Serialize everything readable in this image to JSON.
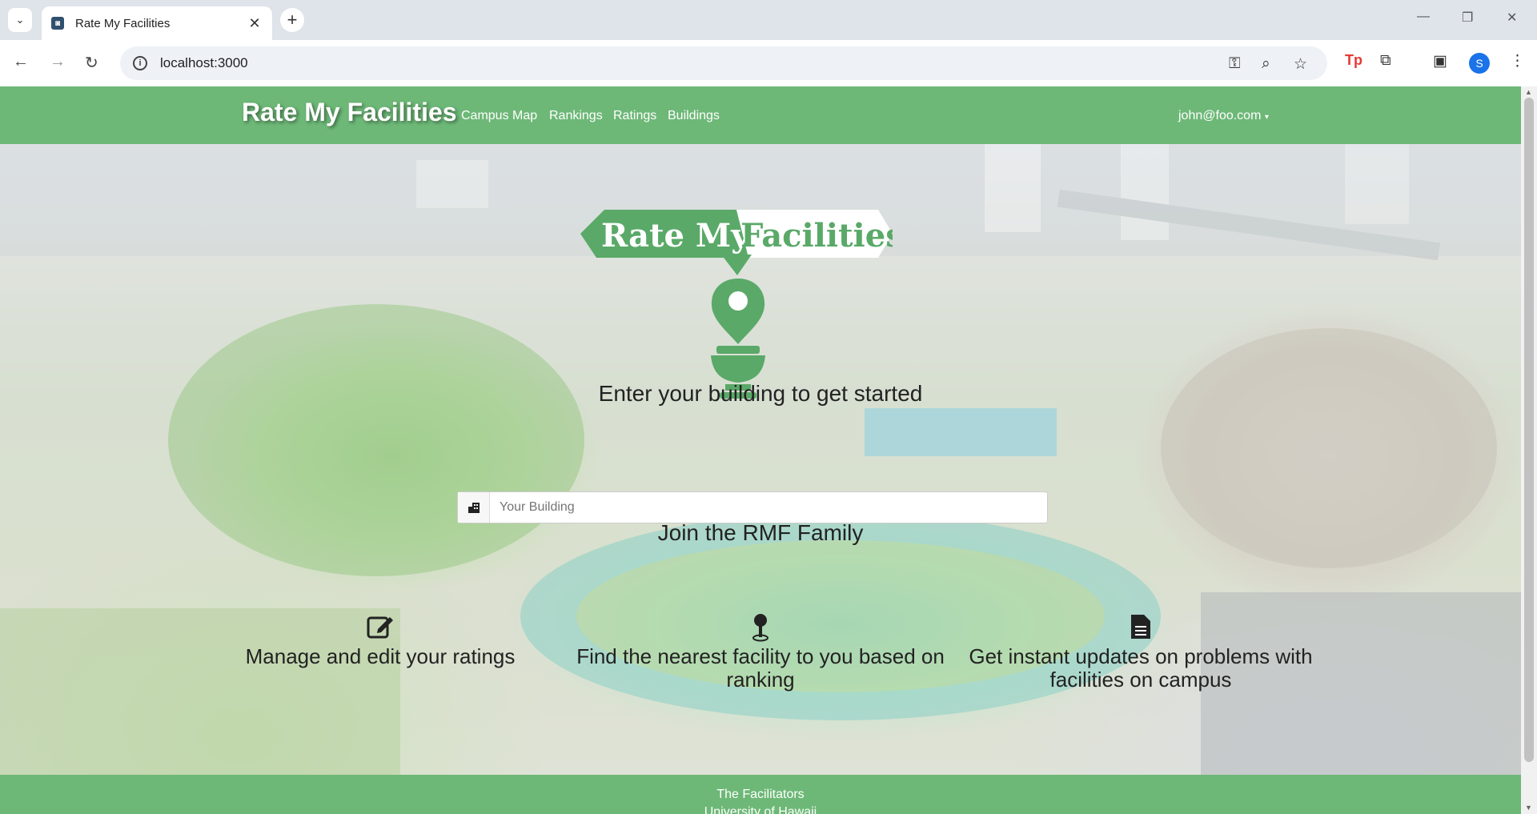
{
  "browser": {
    "tab_title": "Rate My Facilities",
    "url": "localhost:3000",
    "profile_initial": "S",
    "extension_badge": "Tp"
  },
  "navbar": {
    "brand": "Rate My Facilities",
    "links": [
      "Campus Map",
      "Rankings",
      "Ratings",
      "Buildings"
    ],
    "user": "john@foo.com"
  },
  "hero": {
    "logo_text_left": "Rate My",
    "logo_text_right": "Facilities",
    "prompt": "Enter your building to get started",
    "search_placeholder": "Your Building",
    "join_heading": "Join the RMF Family",
    "features": [
      {
        "icon": "edit-icon",
        "text": "Manage and edit your ratings"
      },
      {
        "icon": "map-pin-icon",
        "text": "Find the nearest facility to you based on ranking"
      },
      {
        "icon": "document-icon",
        "text": "Get instant updates on problems with facilities on campus"
      }
    ]
  },
  "footer": {
    "line1": "The Facilitators",
    "line2": "University of Hawaii"
  },
  "colors": {
    "brand_green": "#6db877",
    "logo_green": "#5aa968"
  }
}
